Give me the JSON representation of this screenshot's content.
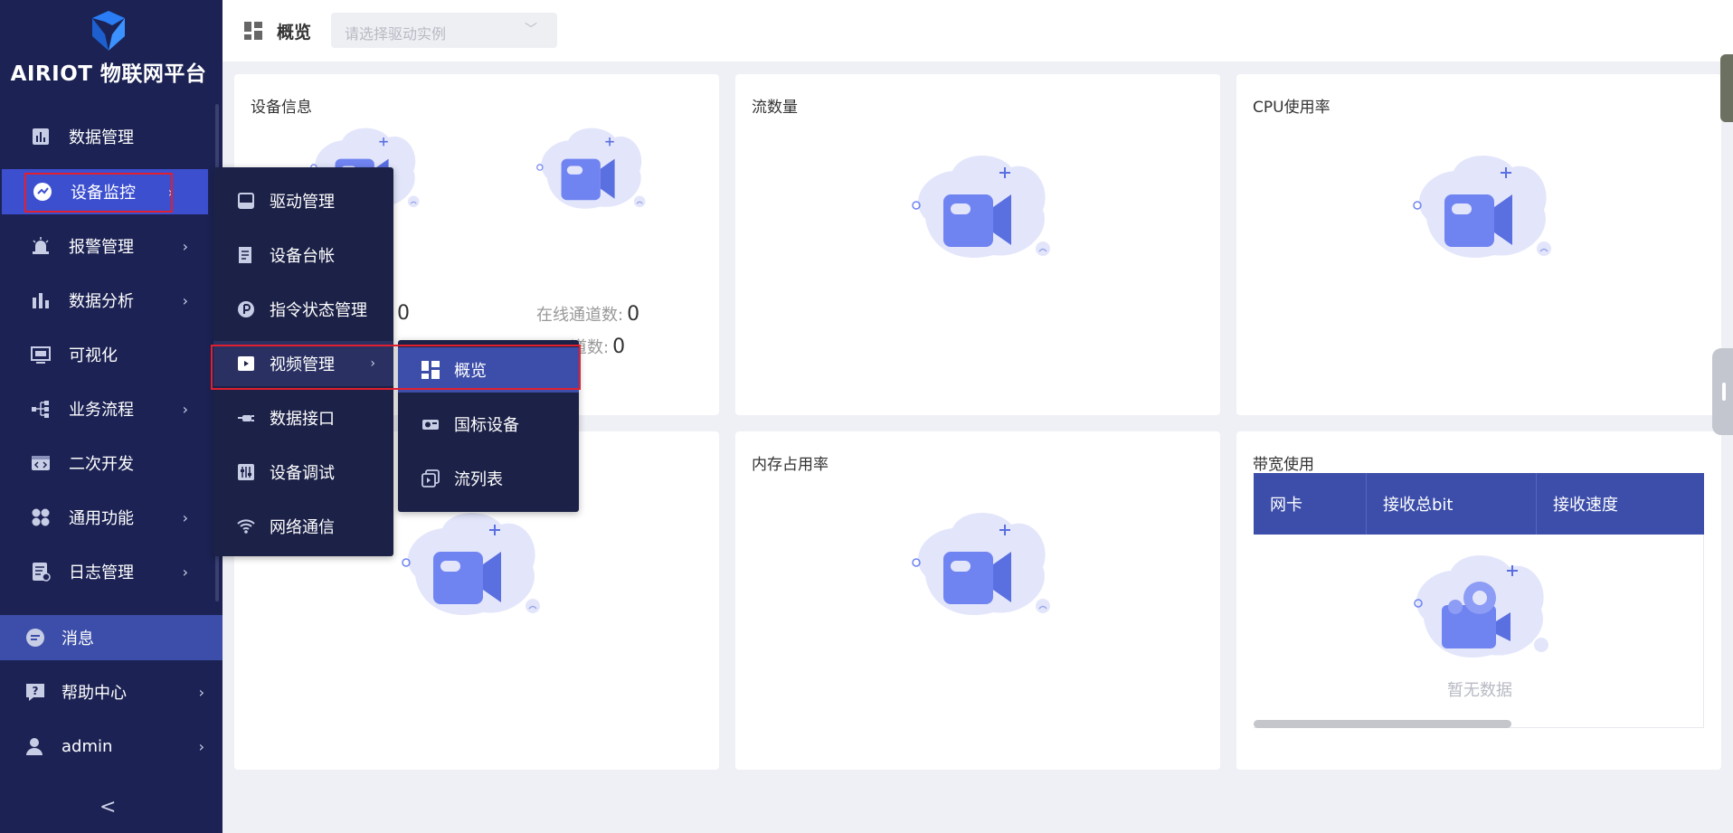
{
  "app": {
    "title": "AIRIOT 物联网平台"
  },
  "sidebar": {
    "items": [
      {
        "label": "数据管理",
        "icon": "bar-chart-icon",
        "has_arrow": false
      },
      {
        "label": "设备监控",
        "icon": "gauge-icon",
        "has_arrow": true
      },
      {
        "label": "报警管理",
        "icon": "alarm-icon",
        "has_arrow": true
      },
      {
        "label": "数据分析",
        "icon": "analysis-icon",
        "has_arrow": true
      },
      {
        "label": "可视化",
        "icon": "screen-icon",
        "has_arrow": false
      },
      {
        "label": "业务流程",
        "icon": "flow-icon",
        "has_arrow": true
      },
      {
        "label": "二次开发",
        "icon": "code-icon",
        "has_arrow": false
      },
      {
        "label": "通用功能",
        "icon": "apps-icon",
        "has_arrow": true
      },
      {
        "label": "日志管理",
        "icon": "log-icon",
        "has_arrow": true
      }
    ],
    "bottom": [
      {
        "label": "消息",
        "icon": "message-icon"
      },
      {
        "label": "帮助中心",
        "icon": "help-icon"
      },
      {
        "label": "admin",
        "icon": "user-icon"
      }
    ],
    "collapse": "<"
  },
  "submenu": {
    "items": [
      {
        "label": "驱动管理",
        "icon": "driver-icon"
      },
      {
        "label": "设备台帐",
        "icon": "ledger-icon"
      },
      {
        "label": "指令状态管理",
        "icon": "command-icon"
      },
      {
        "label": "视频管理",
        "icon": "video-icon"
      },
      {
        "label": "数据接口",
        "icon": "plug-icon"
      },
      {
        "label": "设备调试",
        "icon": "debug-icon"
      },
      {
        "label": "网络通信",
        "icon": "wifi-icon"
      }
    ]
  },
  "video_submenu": {
    "items": [
      {
        "label": "概览",
        "icon": "dashboard-icon"
      },
      {
        "label": "国标设备",
        "icon": "camera-device-icon"
      },
      {
        "label": "流列表",
        "icon": "stream-list-icon"
      }
    ]
  },
  "topbar": {
    "title": "概览",
    "select_placeholder": "请选择驱动实例"
  },
  "cards": {
    "device_info": {
      "title": "设备信息",
      "stat1_value": "0",
      "online_channels_label": "在线通道数:",
      "online_channels_value": "0",
      "stat3_label": "道数:",
      "stat3_value": "0"
    },
    "stream": {
      "title": "流数量"
    },
    "cpu": {
      "title": "CPU使用率"
    },
    "memory": {
      "title": "内存占用率"
    },
    "bandwidth": {
      "title": "带宽使用",
      "columns": [
        "网卡",
        "接收总bit",
        "接收速度"
      ],
      "empty_text": "暂无数据"
    }
  },
  "colors": {
    "sidebar_bg": "#1c2354",
    "accent": "#3c4ea9",
    "highlight": "#3c4fcf",
    "page_bg": "#eff0f5",
    "annotation_red": "#e0202f"
  }
}
